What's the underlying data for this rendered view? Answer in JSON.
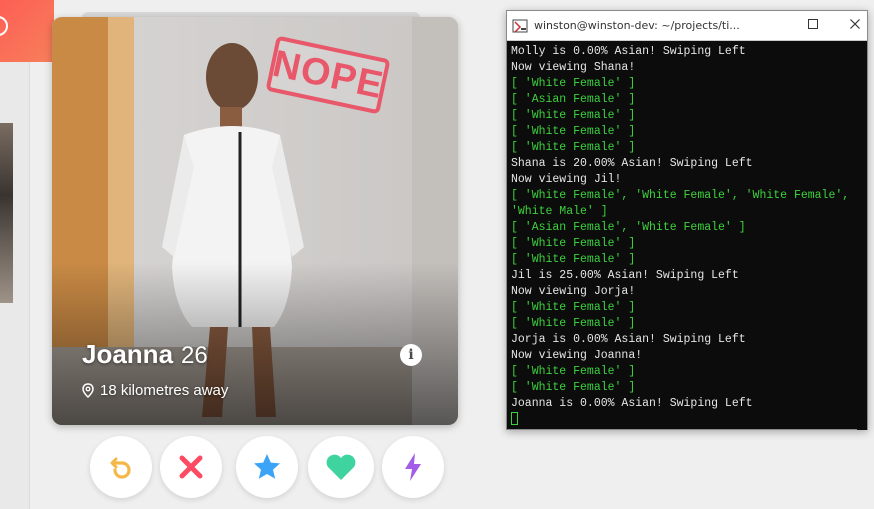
{
  "profile": {
    "name": "Joanna",
    "age": "26",
    "distance": "18 kilometres away",
    "stamp": "NOPE"
  },
  "actions": [
    {
      "icon": "rewind-icon",
      "color": "#f5b748"
    },
    {
      "icon": "nope-x-icon",
      "color": "#fd4b64"
    },
    {
      "icon": "super-like-star-icon",
      "color": "#3ca4f7"
    },
    {
      "icon": "like-heart-icon",
      "color": "#3fd3a0"
    },
    {
      "icon": "boost-bolt-icon",
      "color": "#a35de7"
    }
  ],
  "terminal": {
    "title": "winston@winston-dev: ~/projects/ti...",
    "lines": [
      {
        "text": "Molly is 0.00% Asian! Swiping Left",
        "green": false
      },
      {
        "text": "Now viewing Shana!",
        "green": false
      },
      {
        "text": "[ 'White Female' ]",
        "green": true
      },
      {
        "text": "[ 'Asian Female' ]",
        "green": true
      },
      {
        "text": "[ 'White Female' ]",
        "green": true
      },
      {
        "text": "[ 'White Female' ]",
        "green": true
      },
      {
        "text": "[ 'White Female' ]",
        "green": true
      },
      {
        "text": "Shana is 20.00% Asian! Swiping Left",
        "green": false
      },
      {
        "text": "Now viewing Jil!",
        "green": false
      },
      {
        "text": "[ 'White Female', 'White Female', 'White Female', 'White Male' ]",
        "green": true
      },
      {
        "text": "[ 'Asian Female', 'White Female' ]",
        "green": true
      },
      {
        "text": "[ 'White Female' ]",
        "green": true
      },
      {
        "text": "[ 'White Female' ]",
        "green": true
      },
      {
        "text": "Jil is 25.00% Asian! Swiping Left",
        "green": false
      },
      {
        "text": "Now viewing Jorja!",
        "green": false
      },
      {
        "text": "[ 'White Female' ]",
        "green": true
      },
      {
        "text": "[ 'White Female' ]",
        "green": true
      },
      {
        "text": "Jorja is 0.00% Asian! Swiping Left",
        "green": false
      },
      {
        "text": "Now viewing Joanna!",
        "green": false
      },
      {
        "text": "[ 'White Female' ]",
        "green": true
      },
      {
        "text": "[ 'White Female' ]",
        "green": true
      },
      {
        "text": "Joanna is 0.00% Asian! Swiping Left",
        "green": false
      }
    ]
  }
}
